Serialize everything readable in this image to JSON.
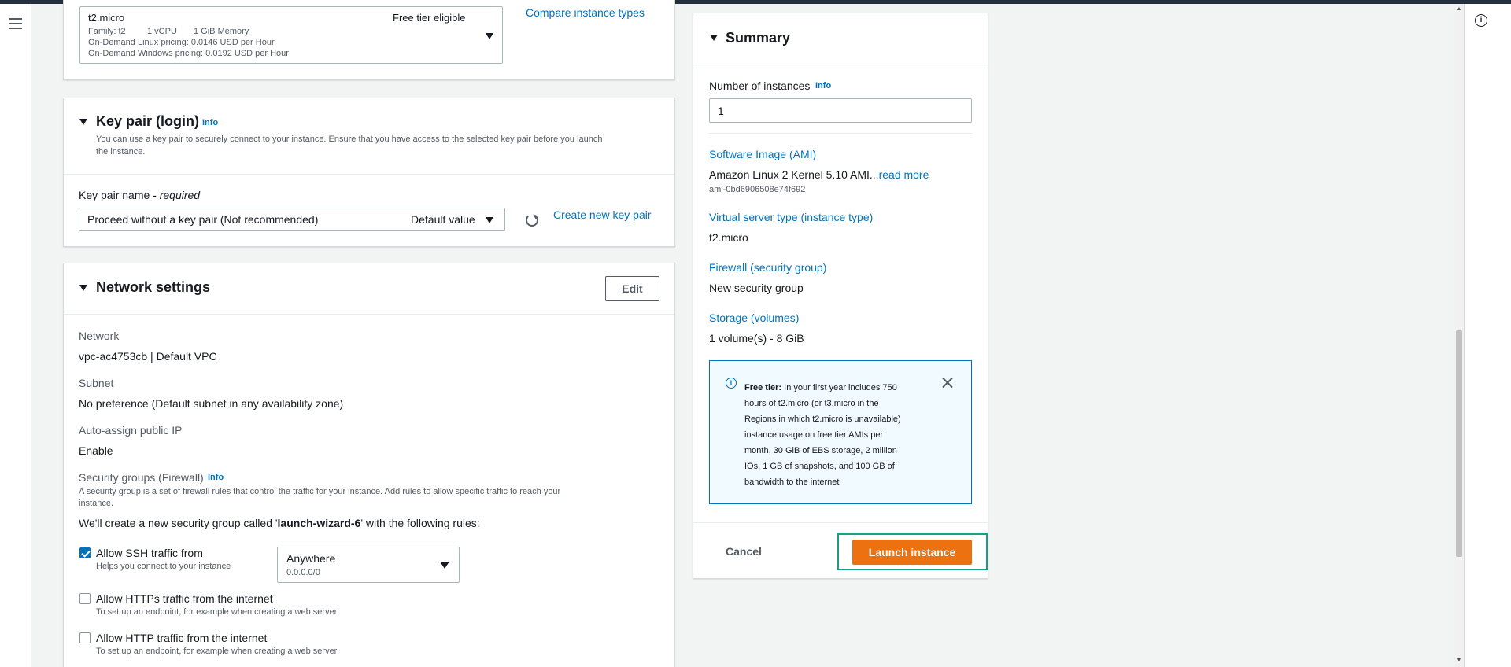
{
  "instance_type": {
    "name": "t2.micro",
    "free_tier": "Free tier eligible",
    "family": "Family: t2",
    "vcpu": "1 vCPU",
    "memory": "1 GiB Memory",
    "linux_pricing": "On-Demand Linux pricing: 0.0146 USD per Hour",
    "windows_pricing": "On-Demand Windows pricing: 0.0192 USD per Hour",
    "compare_link": "Compare instance types"
  },
  "key_pair": {
    "title": "Key pair (login)",
    "info": "Info",
    "description_line1": "You can use a key pair to securely connect to your instance. Ensure that you have access to the selected key pair before you launch",
    "description_line2": "the instance.",
    "field_label": "Key pair name",
    "field_required": "- required",
    "selected_value": "Proceed without a key pair (Not recommended)",
    "selected_tag": "Default value",
    "create_link": "Create new key pair"
  },
  "network": {
    "title": "Network settings",
    "edit_label": "Edit",
    "network_label": "Network",
    "network_value": "vpc-ac4753cb | Default VPC",
    "subnet_label": "Subnet",
    "subnet_value": "No preference (Default subnet in any availability zone)",
    "public_ip_label": "Auto-assign public IP",
    "public_ip_value": "Enable",
    "sg_label": "Security groups (Firewall)",
    "sg_info": "Info",
    "sg_desc_line1": "A security group is a set of firewall rules that control the traffic for your instance. Add rules to allow specific traffic to reach your",
    "sg_desc_line2": "instance.",
    "sg_create_prefix": "We'll create a new security group called '",
    "sg_create_name": "launch-wizard-6",
    "sg_create_suffix": "' with the following rules:",
    "rules": [
      {
        "label": "Allow SSH traffic from",
        "hint": "Helps you connect to your instance",
        "checked": true
      },
      {
        "label": "Allow HTTPs traffic from the internet",
        "hint": "To set up an endpoint, for example when creating a web server",
        "checked": false
      },
      {
        "label": "Allow HTTP traffic from the internet",
        "hint": "To set up an endpoint, for example when creating a web server",
        "checked": false
      }
    ],
    "ssh_source_value": "Anywhere",
    "ssh_source_cidr": "0.0.0.0/0"
  },
  "summary": {
    "title": "Summary",
    "num_instances_label": "Number of instances",
    "num_instances_info": "Info",
    "num_instances_value": "1",
    "ami_label": "Software Image (AMI)",
    "ami_value": "Amazon Linux 2 Kernel 5.10 AMI...",
    "ami_read_more": "read more",
    "ami_id": "ami-0bd6906508e74f692",
    "instance_type_label": "Virtual server type (instance type)",
    "instance_type_value": "t2.micro",
    "firewall_label": "Firewall (security group)",
    "firewall_value": "New security group",
    "storage_label": "Storage (volumes)",
    "storage_value": "1 volume(s) - 8 GiB",
    "free_tier_title": "Free tier:",
    "free_tier_lines": [
      " In your first year includes 750",
      "hours of t2.micro (or t3.micro in the",
      "Regions in which t2.micro is unavailable)",
      "instance usage on free tier AMIs per",
      "month, 30 GiB of EBS storage, 2 million",
      "IOs, 1 GB of snapshots, and 100 GB of",
      "bandwidth to the internet"
    ],
    "cancel_label": "Cancel",
    "launch_label": "Launch instance"
  },
  "icons": {
    "menu": "hamburger-menu-icon",
    "info": "info-circle-icon",
    "refresh": "refresh-icon",
    "close": "close-icon",
    "dropdown": "caret-down-icon"
  },
  "colors": {
    "link": "#0073bb",
    "launch_button": "#ec7211",
    "focus_ring": "#16a085",
    "alert_bg": "#f1faff"
  }
}
